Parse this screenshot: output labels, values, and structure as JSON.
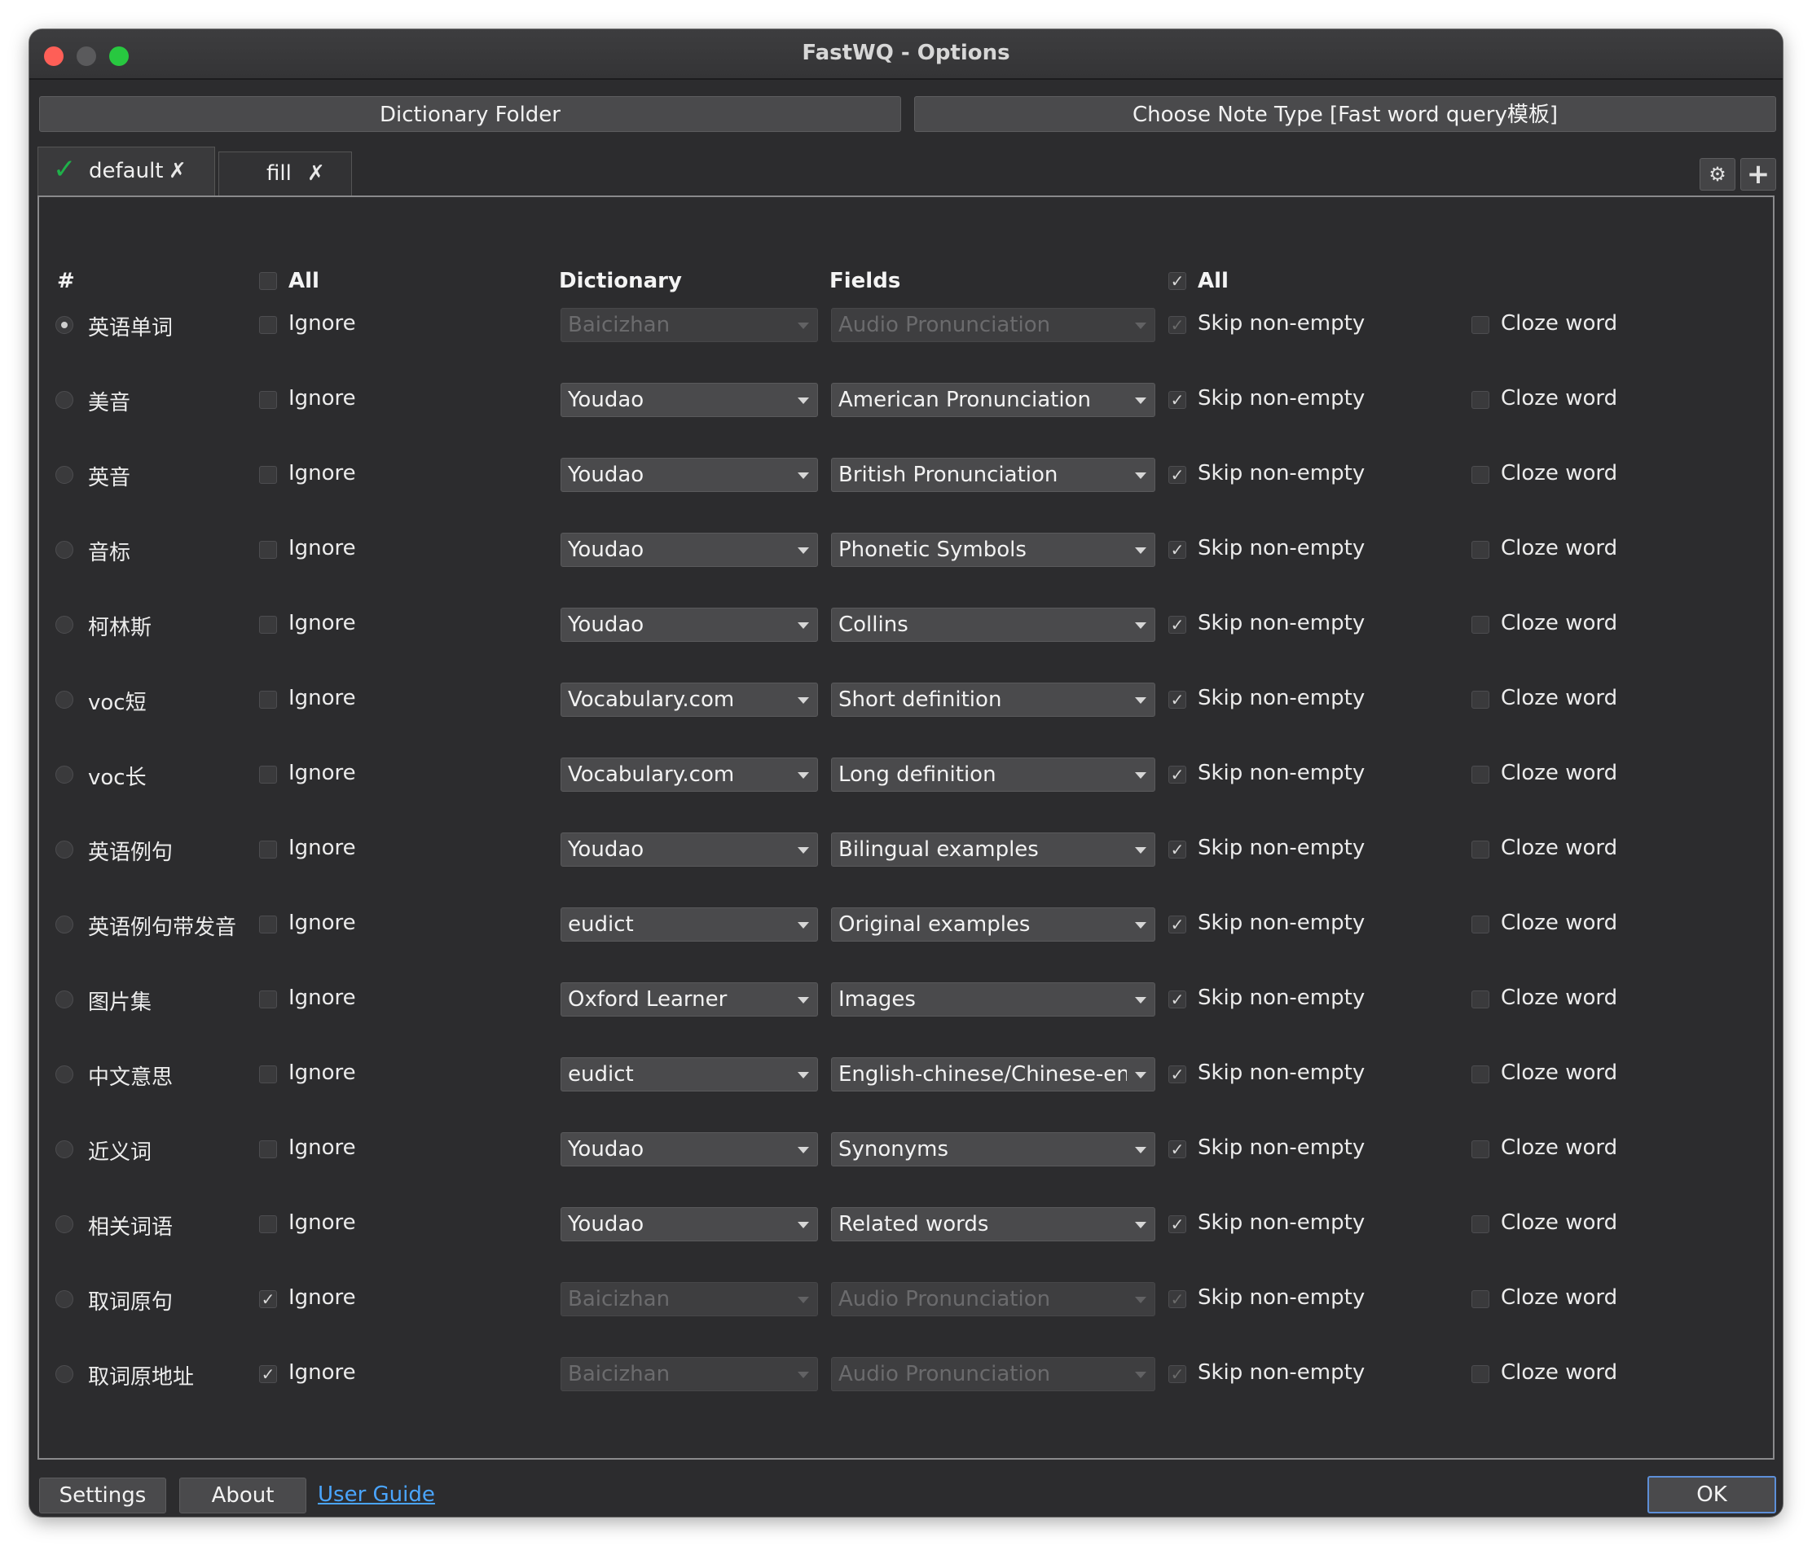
{
  "window": {
    "title": "FastWQ - Options"
  },
  "toolbar": {
    "dictionary_folder": "Dictionary Folder",
    "choose_note_type": "Choose Note Type [Fast word query模板]"
  },
  "tabs": [
    {
      "label": "default",
      "active": true
    },
    {
      "label": "fill",
      "active": false
    }
  ],
  "header": {
    "hash": "#",
    "ignore_all": "All",
    "dictionary": "Dictionary",
    "fields": "Fields",
    "skip_all": "All",
    "skip_all_checked": true,
    "ignore_all_checked": false
  },
  "labels": {
    "ignore": "Ignore",
    "skip": "Skip non-empty",
    "cloze": "Cloze word",
    "check": "✓"
  },
  "rows": [
    {
      "field": "英语单词",
      "selected": true,
      "ignore": false,
      "dict": "Baicizhan",
      "dict_field": "Audio Pronunciation",
      "disabled": true,
      "skip": true,
      "cloze": false
    },
    {
      "field": "美音",
      "selected": false,
      "ignore": false,
      "dict": "Youdao",
      "dict_field": "American Pronunciation",
      "disabled": false,
      "skip": true,
      "cloze": false
    },
    {
      "field": "英音",
      "selected": false,
      "ignore": false,
      "dict": "Youdao",
      "dict_field": "British Pronunciation",
      "disabled": false,
      "skip": true,
      "cloze": false
    },
    {
      "field": "音标",
      "selected": false,
      "ignore": false,
      "dict": "Youdao",
      "dict_field": "Phonetic Symbols",
      "disabled": false,
      "skip": true,
      "cloze": false
    },
    {
      "field": "柯林斯",
      "selected": false,
      "ignore": false,
      "dict": "Youdao",
      "dict_field": "Collins",
      "disabled": false,
      "skip": true,
      "cloze": false
    },
    {
      "field": "voc短",
      "selected": false,
      "ignore": false,
      "dict": "Vocabulary.com",
      "dict_field": "Short definition",
      "disabled": false,
      "skip": true,
      "cloze": false
    },
    {
      "field": "voc长",
      "selected": false,
      "ignore": false,
      "dict": "Vocabulary.com",
      "dict_field": "Long definition",
      "disabled": false,
      "skip": true,
      "cloze": false
    },
    {
      "field": "英语例句",
      "selected": false,
      "ignore": false,
      "dict": "Youdao",
      "dict_field": "Bilingual examples",
      "disabled": false,
      "skip": true,
      "cloze": false
    },
    {
      "field": "英语例句带发音",
      "selected": false,
      "ignore": false,
      "dict": "eudict",
      "dict_field": "Original examples",
      "disabled": false,
      "skip": true,
      "cloze": false
    },
    {
      "field": "图片集",
      "selected": false,
      "ignore": false,
      "dict": "Oxford Learner",
      "dict_field": "Images",
      "disabled": false,
      "skip": true,
      "cloze": false
    },
    {
      "field": "中文意思",
      "selected": false,
      "ignore": false,
      "dict": "eudict",
      "dict_field": "English-chinese/Chinese-eng",
      "disabled": false,
      "skip": true,
      "cloze": false
    },
    {
      "field": "近义词",
      "selected": false,
      "ignore": false,
      "dict": "Youdao",
      "dict_field": "Synonyms",
      "disabled": false,
      "skip": true,
      "cloze": false
    },
    {
      "field": "相关词语",
      "selected": false,
      "ignore": false,
      "dict": "Youdao",
      "dict_field": "Related words",
      "disabled": false,
      "skip": true,
      "cloze": false
    },
    {
      "field": "取词原句",
      "selected": false,
      "ignore": true,
      "dict": "Baicizhan",
      "dict_field": "Audio Pronunciation",
      "disabled": true,
      "skip": true,
      "cloze": false
    },
    {
      "field": "取词原地址",
      "selected": false,
      "ignore": true,
      "dict": "Baicizhan",
      "dict_field": "Audio Pronunciation",
      "disabled": true,
      "skip": true,
      "cloze": false
    }
  ],
  "footer": {
    "settings": "Settings",
    "about": "About",
    "user_guide": "User Guide",
    "ok": "OK"
  },
  "icons": {
    "gear": "⚙",
    "plus": "+",
    "tab_close": "✗",
    "tab_check": "✓"
  },
  "colors": {
    "accent_green": "#1fb14a",
    "link_blue": "#4aa5ff",
    "ok_border": "#5d8fd8"
  }
}
